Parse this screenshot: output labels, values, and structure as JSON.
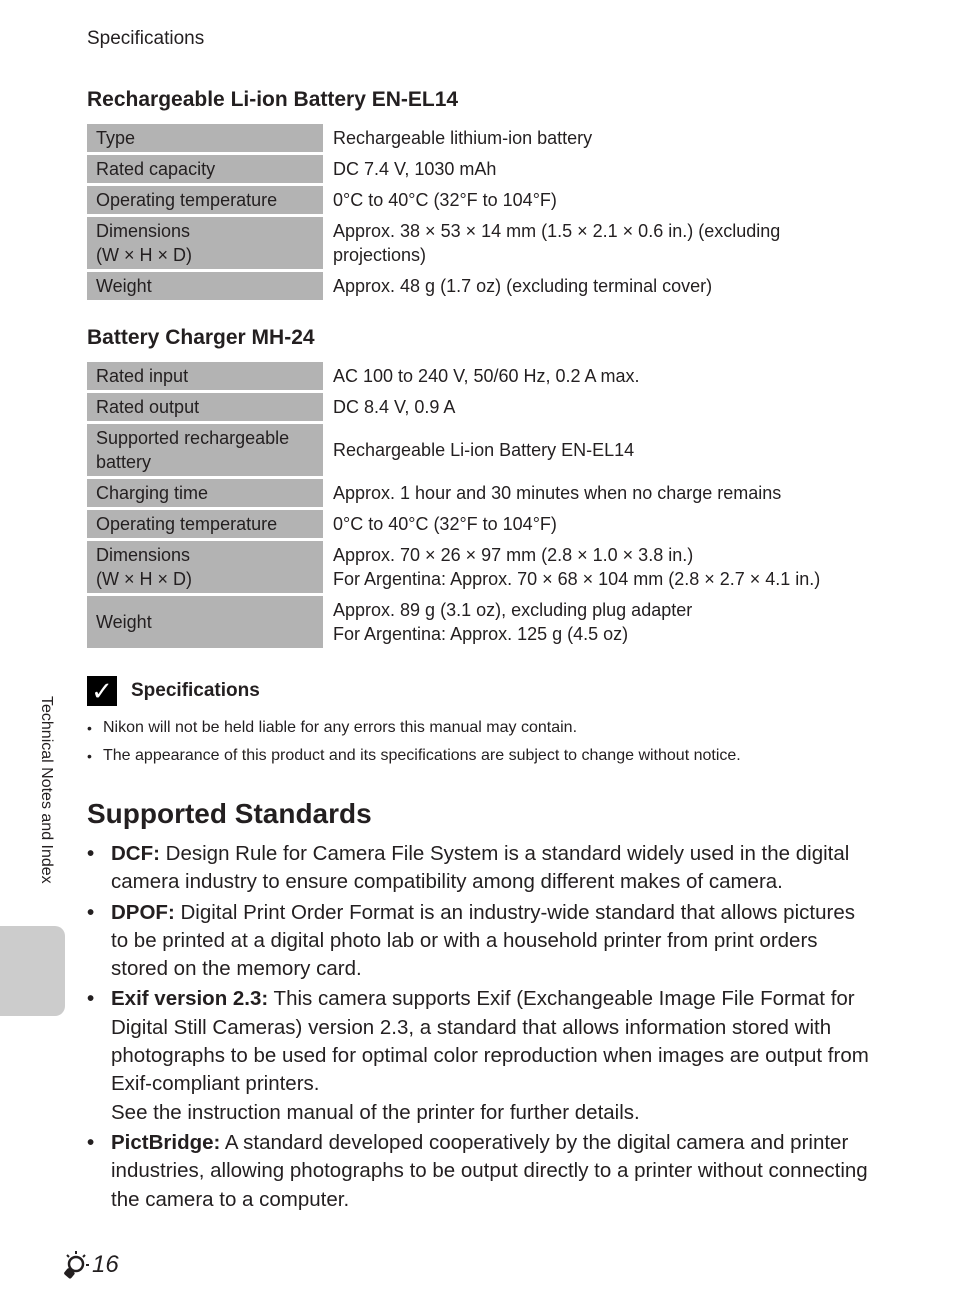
{
  "running_head": "Specifications",
  "battery": {
    "title": "Rechargeable Li-ion Battery EN-EL14",
    "rows": [
      {
        "key": "Type",
        "value": "Rechargeable lithium-ion battery"
      },
      {
        "key": "Rated capacity",
        "value": "DC 7.4 V, 1030 mAh"
      },
      {
        "key": "Operating temperature",
        "value": "0°C to 40°C  (32°F to 104°F)"
      },
      {
        "key": "Dimensions\n(W × H × D)",
        "value": "Approx. 38 × 53 × 14 mm (1.5 × 2.1 × 0.6 in.) (excluding projections)"
      },
      {
        "key": "Weight",
        "value": "Approx. 48 g (1.7 oz) (excluding terminal cover)"
      }
    ]
  },
  "charger": {
    "title": "Battery Charger MH-24",
    "rows": [
      {
        "key": "Rated input",
        "value": "AC 100 to 240 V, 50/60 Hz, 0.2 A max."
      },
      {
        "key": "Rated output",
        "value": "DC 8.4 V, 0.9 A"
      },
      {
        "key": "Supported rechargeable battery",
        "value": "Rechargeable Li-ion Battery EN-EL14"
      },
      {
        "key": "Charging time",
        "value": "Approx. 1 hour and 30 minutes when no charge remains"
      },
      {
        "key": "Operating temperature",
        "value": "0°C to 40°C  (32°F to 104°F)"
      },
      {
        "key": "Dimensions\n(W × H × D)",
        "value": "Approx. 70 × 26 × 97 mm (2.8 × 1.0 × 3.8 in.)\nFor Argentina: Approx. 70 × 68 × 104 mm (2.8 × 2.7 × 4.1 in.)"
      },
      {
        "key": "Weight",
        "value": "Approx. 89 g (3.1 oz), excluding plug adapter\nFor Argentina: Approx. 125 g (4.5 oz)"
      }
    ]
  },
  "note": {
    "icon": "check-icon",
    "title": "Specifications",
    "items": [
      "Nikon will not be held liable for any errors this manual may contain.",
      "The appearance of this product and its specifications are subject to change without notice."
    ]
  },
  "standards": {
    "title": "Supported Standards",
    "items": [
      {
        "term": "DCF:",
        "text": " Design Rule for Camera File System is a standard widely used in the digital camera industry to ensure compatibility among different makes of camera."
      },
      {
        "term": "DPOF:",
        "text": " Digital Print Order Format is an industry-wide standard that allows pictures to be printed at a digital photo lab or with a household printer from print orders stored on the memory card."
      },
      {
        "term": "Exif version 2.3:",
        "text": " This camera supports Exif (Exchangeable Image File Format for Digital Still Cameras) version 2.3, a standard that allows information stored with photographs to be used for optimal color reproduction when images are output from Exif-compliant printers.",
        "extra": "See the instruction manual of the printer for further details."
      },
      {
        "term": "PictBridge:",
        "text": " A standard developed cooperatively by the digital camera and printer industries, allowing photographs to be output directly to a printer without connecting the camera to a computer."
      }
    ]
  },
  "side_tab": {
    "label": "Technical Notes and Index"
  },
  "footer": {
    "icon": "tips-bulb-icon",
    "page": "16"
  }
}
